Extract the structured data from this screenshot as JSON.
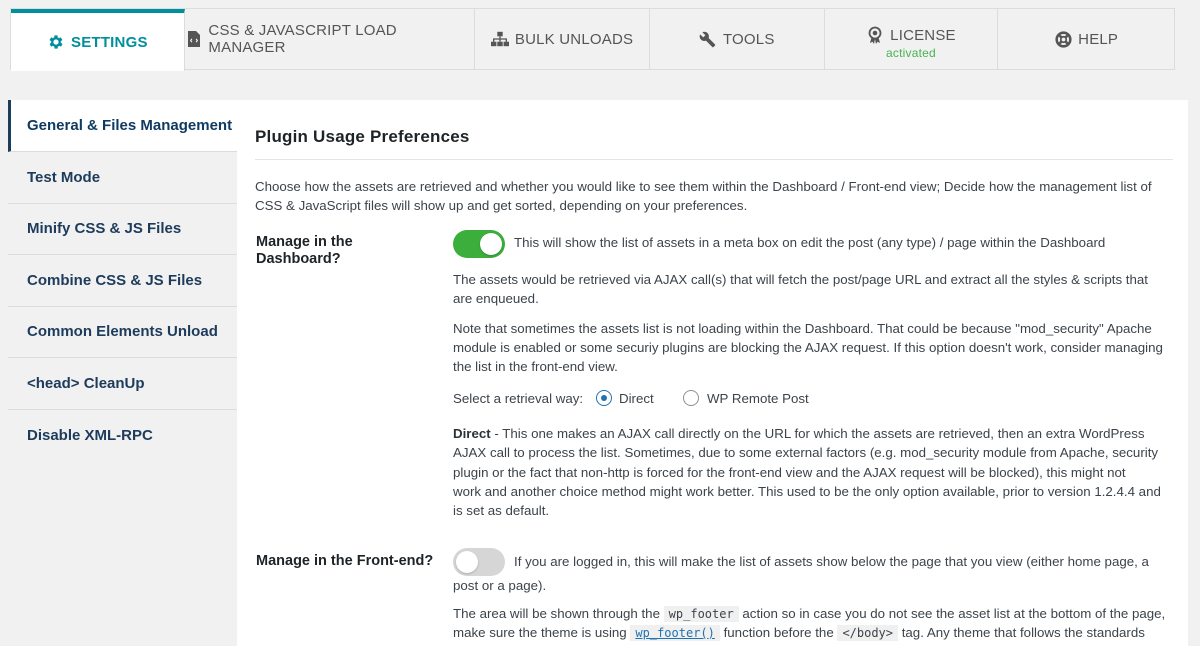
{
  "tabs": [
    {
      "label": "SETTINGS",
      "icon": "gear-icon",
      "active": true
    },
    {
      "label": "CSS & JAVASCRIPT LOAD MANAGER",
      "icon": "code-file-icon"
    },
    {
      "label": "BULK UNLOADS",
      "icon": "sitemap-icon"
    },
    {
      "label": "TOOLS",
      "icon": "wrench-icon"
    },
    {
      "label": "LICENSE",
      "icon": "award-icon",
      "sub": "activated"
    },
    {
      "label": "HELP",
      "icon": "life-ring-icon"
    }
  ],
  "nav": [
    {
      "label": "General & Files Management",
      "active": true
    },
    {
      "label": "Test Mode"
    },
    {
      "label": "Minify CSS & JS Files"
    },
    {
      "label": "Combine CSS & JS Files"
    },
    {
      "label": "Common Elements Unload"
    },
    {
      "label": "<head> CleanUp"
    },
    {
      "label": "Disable XML-RPC"
    }
  ],
  "main": {
    "title": "Plugin Usage Preferences",
    "intro_1": "Choose how the assets are retrieved and whether you would like to see them within the Dashboard / Front-end view; Decide how the management list of",
    "intro_2": "CSS & JavaScript files will show up and get sorted, depending on your preferences.",
    "dashboard": {
      "label_1": "Manage in the",
      "label_2": "Dashboard?",
      "toggle_on": true,
      "toggle_text": "This will show the list of assets in a meta box on edit the post (any type) / page within the Dashboard",
      "ajax_1": "The assets would be retrieved via AJAX call(s) that will fetch the post/page URL and extract all the styles & scripts that",
      "ajax_2": "are enqueued.",
      "note_1": "Note that sometimes the assets list is not loading within the Dashboard. That could be because \"mod_security\" Apache",
      "note_2": "module is enabled or some securiy plugins are blocking the AJAX request. If this option doesn't work, consider managing",
      "note_3": "the list in the front-end view.",
      "retrieval_label": "Select a retrieval way:",
      "option_direct": "Direct",
      "option_wp_remote": "WP Remote Post",
      "selected": "Direct",
      "direct_strong": "Direct",
      "direct_1": " - This one makes an AJAX call directly on the URL for which the assets are retrieved, then an extra WordPress",
      "direct_2": "AJAX call to process the list. Sometimes, due to some external factors (e.g. mod_security module from Apache, security",
      "direct_3": "plugin or the fact that non-http is forced for the front-end view and the AJAX request will be blocked), this might not",
      "direct_4": "work and another choice method might work better. This used to be the only option available, prior to version 1.2.4.4 and",
      "direct_5": "is set as default."
    },
    "frontend": {
      "label": "Manage in the Front-end?",
      "toggle_on": false,
      "toggle_text_1": "If you are logged in, this will make the list of assets show below the page that you view (either home page, a",
      "toggle_text_2": "post or a page).",
      "area_1a": "The area will be shown through the",
      "area_code_1": "wp_footer",
      "area_1b": "action so in case you do not see the asset list at the bottom of the page,",
      "area_2a": "make sure the theme is using",
      "area_code_2": "wp_footer()",
      "area_2b": "function before the",
      "area_code_3": "</body>",
      "area_2c": "tag. Any theme that follows the standards"
    }
  },
  "colors": {
    "accent": "#008f9c",
    "toggle_on": "#3cae3c",
    "nav_text": "#1d3b5b",
    "license_status": "#46b450"
  }
}
